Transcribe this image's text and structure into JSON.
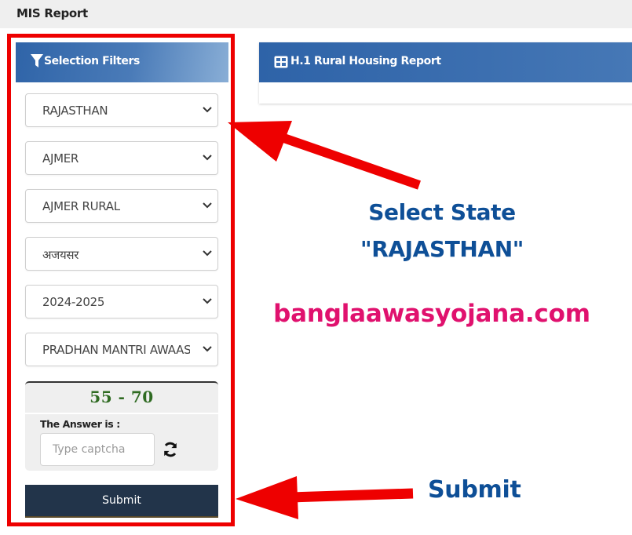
{
  "app": {
    "title": "MIS Report"
  },
  "filters": {
    "heading": "Selection Filters",
    "heading_icon": "filter-icon",
    "selects": [
      {
        "name": "state-select",
        "value": "RAJASTHAN"
      },
      {
        "name": "district-select",
        "value": "AJMER"
      },
      {
        "name": "block-select",
        "value": "AJMER RURAL"
      },
      {
        "name": "gram-panchayat-select",
        "value": "अजयसर"
      },
      {
        "name": "financial-year-select",
        "value": "2024-2025"
      },
      {
        "name": "scheme-select",
        "value": "PRADHAN MANTRI AWAAS YOJANA"
      }
    ],
    "captcha": {
      "code": "55 - 70",
      "label": "The Answer is :",
      "placeholder": "Type captcha",
      "value": "",
      "refresh_icon": "refresh-icon"
    },
    "submit_label": "Submit"
  },
  "report": {
    "heading": "H.1 Rural Housing Report",
    "heading_icon": "table-icon"
  },
  "annotations": {
    "select_state_line1": "Select State",
    "select_state_line2": "\"RAJASTHAN\"",
    "website": "banglaawasyojana.com",
    "submit_hint": "Submit",
    "colors": {
      "arrow": "#ee0000",
      "hint_text": "#0e4f97",
      "website_text": "#e0116e"
    }
  }
}
